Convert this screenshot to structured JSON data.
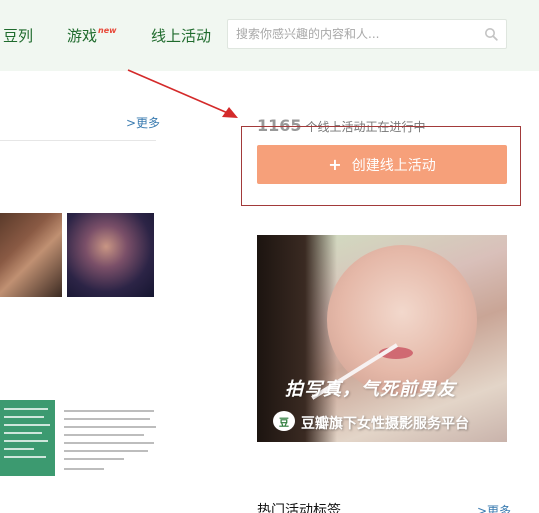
{
  "nav": {
    "items": [
      {
        "label": "豆列"
      },
      {
        "label": "游戏",
        "badge": "new"
      },
      {
        "label": "线上活动"
      }
    ],
    "search": {
      "placeholder": "搜索你感兴趣的内容和人..."
    }
  },
  "left": {
    "more_label": ">更多"
  },
  "right": {
    "count": "1165",
    "count_text": "个线上活动正在进行中",
    "create_button_label": "创建线上活动",
    "banner": {
      "line1": "拍写真，气死前男友",
      "logo": "豆",
      "line2": "豆瓣旗下女性摄影服务平台"
    },
    "hot_title": "热门活动标签",
    "more_label": ">更多"
  },
  "colors": {
    "nav_bg": "#f1f7f1",
    "nav_text": "#1f6b2d",
    "button_bg": "#f6a07a",
    "highlight_border": "#a23a3a",
    "arrow": "#d42a2a",
    "link": "#3a7bb0"
  }
}
